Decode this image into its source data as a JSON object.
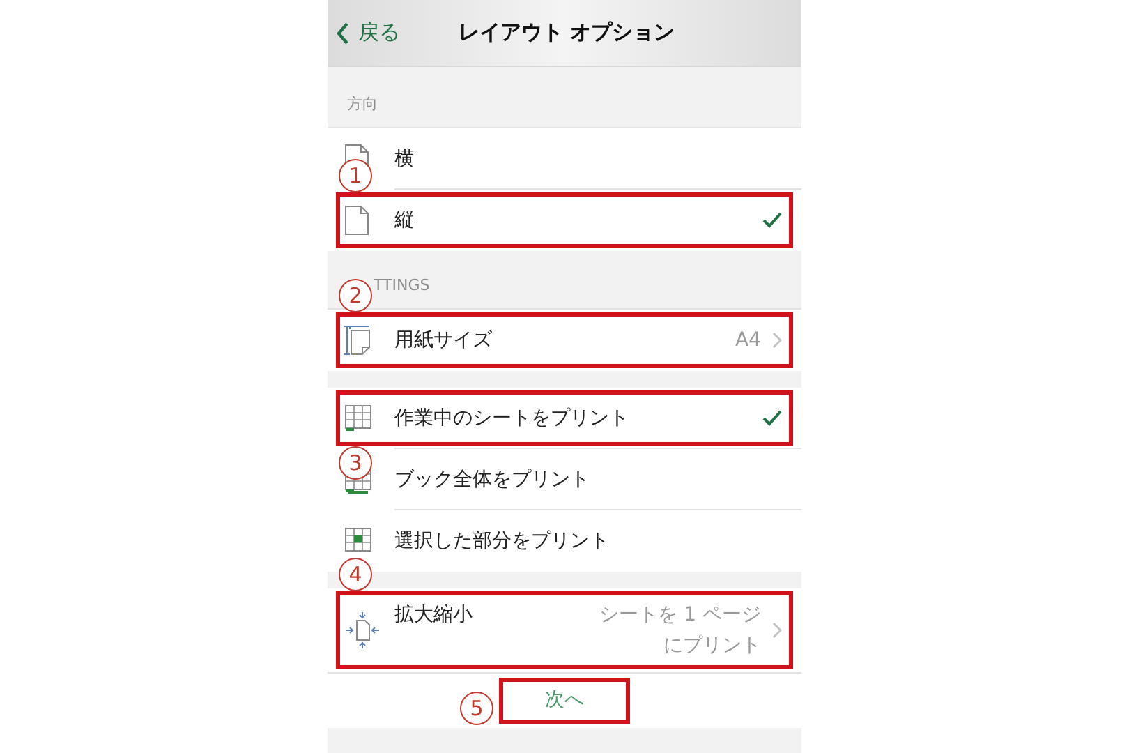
{
  "header": {
    "back": "戻る",
    "title": "レイアウト オプション"
  },
  "sections": [
    {
      "label": "方向",
      "rows": [
        {
          "kind": "landscape",
          "label": "横",
          "selected": false,
          "highlighted": false
        },
        {
          "kind": "portrait",
          "label": "縦",
          "selected": true,
          "highlighted": true,
          "badge": "1"
        }
      ]
    },
    {
      "label": "TTINGS",
      "rows": [
        {
          "kind": "paper",
          "label": "用紙サイズ",
          "value": "A4",
          "disclosure": true,
          "highlighted": true,
          "badge": "2"
        }
      ]
    },
    {
      "rows": [
        {
          "kind": "sheet",
          "label": "作業中のシートをプリント",
          "selected": true,
          "highlighted": true,
          "badge": "3",
          "badge_below": true
        },
        {
          "kind": "book",
          "label": "ブック全体をプリント",
          "selected": false,
          "highlighted": false
        },
        {
          "kind": "selection",
          "label": "選択した部分をプリント",
          "selected": false,
          "highlighted": false
        }
      ]
    },
    {
      "rows": [
        {
          "kind": "scale",
          "label": "拡大縮小",
          "value": "シートを 1 ページにプリント",
          "disclosure": true,
          "highlighted": true,
          "badge": "4",
          "tall": true
        }
      ]
    }
  ],
  "next_button": {
    "label": "次へ",
    "highlighted": true,
    "badge": "5"
  }
}
